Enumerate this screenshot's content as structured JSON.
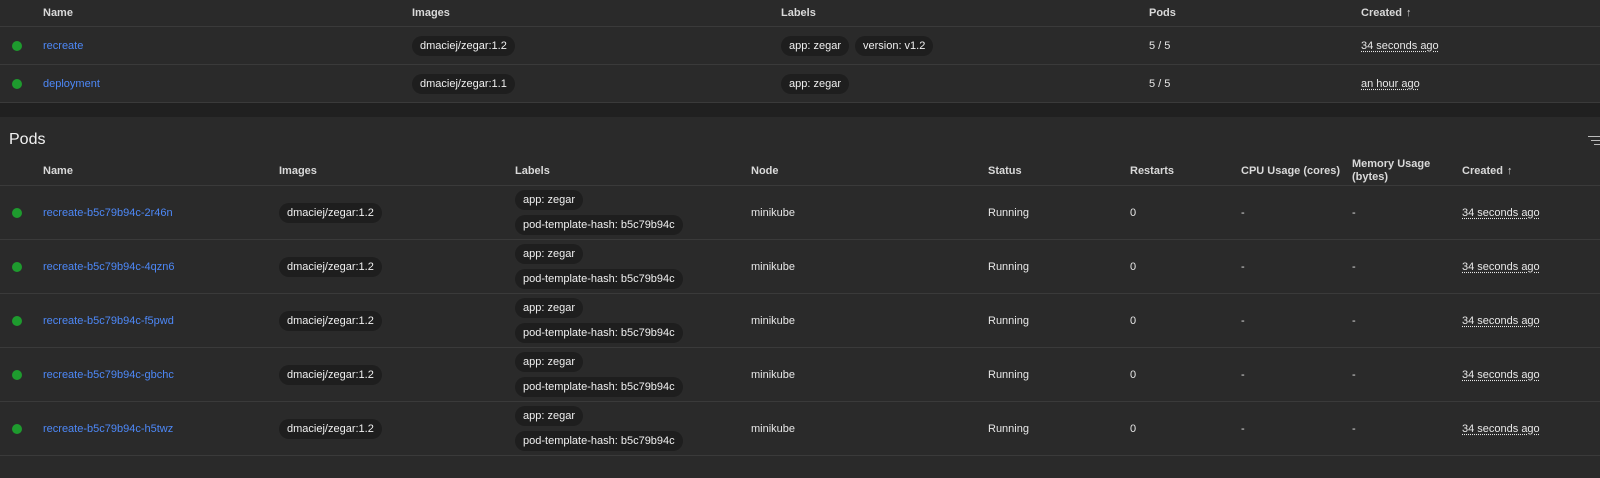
{
  "deployments": {
    "columns": {
      "name": "Name",
      "images": "Images",
      "labels": "Labels",
      "pods": "Pods",
      "created": "Created"
    },
    "sort_icon": "arrow-up-icon",
    "rows": [
      {
        "name": "recreate",
        "image": "dmaciej/zegar:1.2",
        "labels": [
          "app: zegar",
          "version: v1.2"
        ],
        "pods": "5 / 5",
        "created": "34 seconds ago"
      },
      {
        "name": "deployment",
        "image": "dmaciej/zegar:1.1",
        "labels": [
          "app: zegar"
        ],
        "pods": "5 / 5",
        "created": "an hour ago"
      }
    ]
  },
  "pods": {
    "title": "Pods",
    "columns": {
      "name": "Name",
      "images": "Images",
      "labels": "Labels",
      "node": "Node",
      "status": "Status",
      "restarts": "Restarts",
      "cpu": "CPU Usage (cores)",
      "memory": "Memory Usage (bytes)",
      "created": "Created"
    },
    "rows": [
      {
        "name": "recreate-b5c79b94c-2r46n",
        "image": "dmaciej/zegar:1.2",
        "labels": [
          "app: zegar",
          "pod-template-hash: b5c79b94c"
        ],
        "node": "minikube",
        "status": "Running",
        "restarts": "0",
        "cpu": "-",
        "memory": "-",
        "created": "34 seconds ago"
      },
      {
        "name": "recreate-b5c79b94c-4qzn6",
        "image": "dmaciej/zegar:1.2",
        "labels": [
          "app: zegar",
          "pod-template-hash: b5c79b94c"
        ],
        "node": "minikube",
        "status": "Running",
        "restarts": "0",
        "cpu": "-",
        "memory": "-",
        "created": "34 seconds ago"
      },
      {
        "name": "recreate-b5c79b94c-f5pwd",
        "image": "dmaciej/zegar:1.2",
        "labels": [
          "app: zegar",
          "pod-template-hash: b5c79b94c"
        ],
        "node": "minikube",
        "status": "Running",
        "restarts": "0",
        "cpu": "-",
        "memory": "-",
        "created": "34 seconds ago"
      },
      {
        "name": "recreate-b5c79b94c-gbchc",
        "image": "dmaciej/zegar:1.2",
        "labels": [
          "app: zegar",
          "pod-template-hash: b5c79b94c"
        ],
        "node": "minikube",
        "status": "Running",
        "restarts": "0",
        "cpu": "-",
        "memory": "-",
        "created": "34 seconds ago"
      },
      {
        "name": "recreate-b5c79b94c-h5twz",
        "image": "dmaciej/zegar:1.2",
        "labels": [
          "app: zegar",
          "pod-template-hash: b5c79b94c"
        ],
        "node": "minikube",
        "status": "Running",
        "restarts": "0",
        "cpu": "-",
        "memory": "-",
        "created": "34 seconds ago"
      }
    ]
  },
  "colors": {
    "status_ok": "#1e9b2e",
    "link": "#4d88f7"
  }
}
